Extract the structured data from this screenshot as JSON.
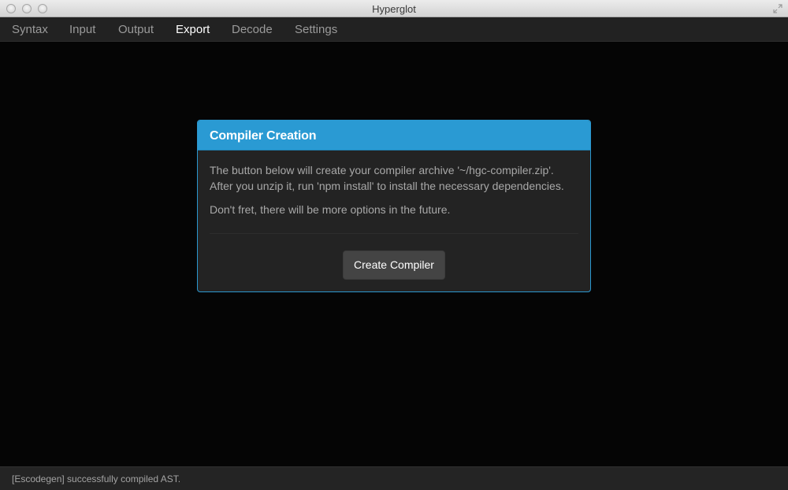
{
  "window": {
    "title": "Hyperglot"
  },
  "menu": {
    "tabs": [
      {
        "label": "Syntax",
        "active": false
      },
      {
        "label": "Input",
        "active": false
      },
      {
        "label": "Output",
        "active": false
      },
      {
        "label": "Export",
        "active": true
      },
      {
        "label": "Decode",
        "active": false
      },
      {
        "label": "Settings",
        "active": false
      }
    ]
  },
  "modal": {
    "title": "Compiler Creation",
    "line1": "The button below will create your compiler archive '~/hgc-compiler.zip'.",
    "line2": "After you unzip it, run 'npm install' to install the necessary dependencies.",
    "line3": "Don't fret, there will be more options in the future.",
    "button_label": "Create Compiler"
  },
  "status": {
    "message": "[Escodegen] successfully compiled AST."
  },
  "colors": {
    "accent": "#2a9ad3",
    "background": "#050505",
    "panel": "#232323"
  },
  "icons": {
    "close": "close-icon",
    "minimize": "minimize-icon",
    "zoom": "zoom-icon",
    "fullscreen": "fullscreen-icon"
  }
}
